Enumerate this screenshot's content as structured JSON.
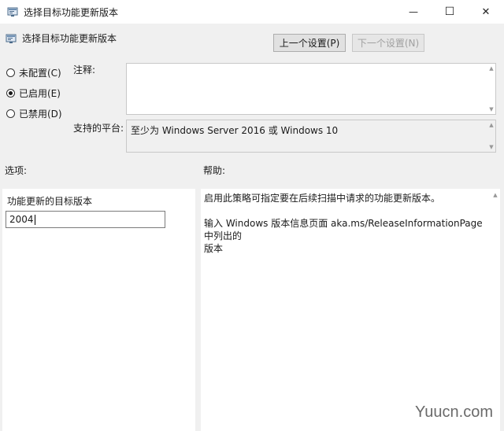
{
  "window": {
    "title": "选择目标功能更新版本",
    "minimize_glyph": "—",
    "maximize_glyph": "☐",
    "close_glyph": "✕"
  },
  "header": {
    "title": "选择目标功能更新版本",
    "prev_button": "上一个设置(P)",
    "next_button": "下一个设置(N)"
  },
  "state_options": [
    {
      "label": "未配置(C)",
      "checked": false
    },
    {
      "label": "已启用(E)",
      "checked": true
    },
    {
      "label": "已禁用(D)",
      "checked": false
    }
  ],
  "comment": {
    "label": "注释:",
    "value": ""
  },
  "supported": {
    "label": "支持的平台:",
    "value": "至少为 Windows Server 2016 或 Windows 10"
  },
  "options": {
    "label": "选项:",
    "field_label": "功能更新的目标版本",
    "field_value": "2004"
  },
  "help": {
    "label": "帮助:",
    "paragraph1": "启用此策略可指定要在后续扫描中请求的功能更新版本。",
    "paragraph2_line1": "输入 Windows 版本信息页面 aka.ms/ReleaseInformationPage 中列出的",
    "paragraph2_line2": "版本"
  },
  "watermark": "Yuucn.com",
  "icons": [
    "policy-icon",
    "minimize-icon",
    "maximize-icon",
    "close-icon",
    "scroll-up-icon",
    "scroll-down-icon"
  ]
}
